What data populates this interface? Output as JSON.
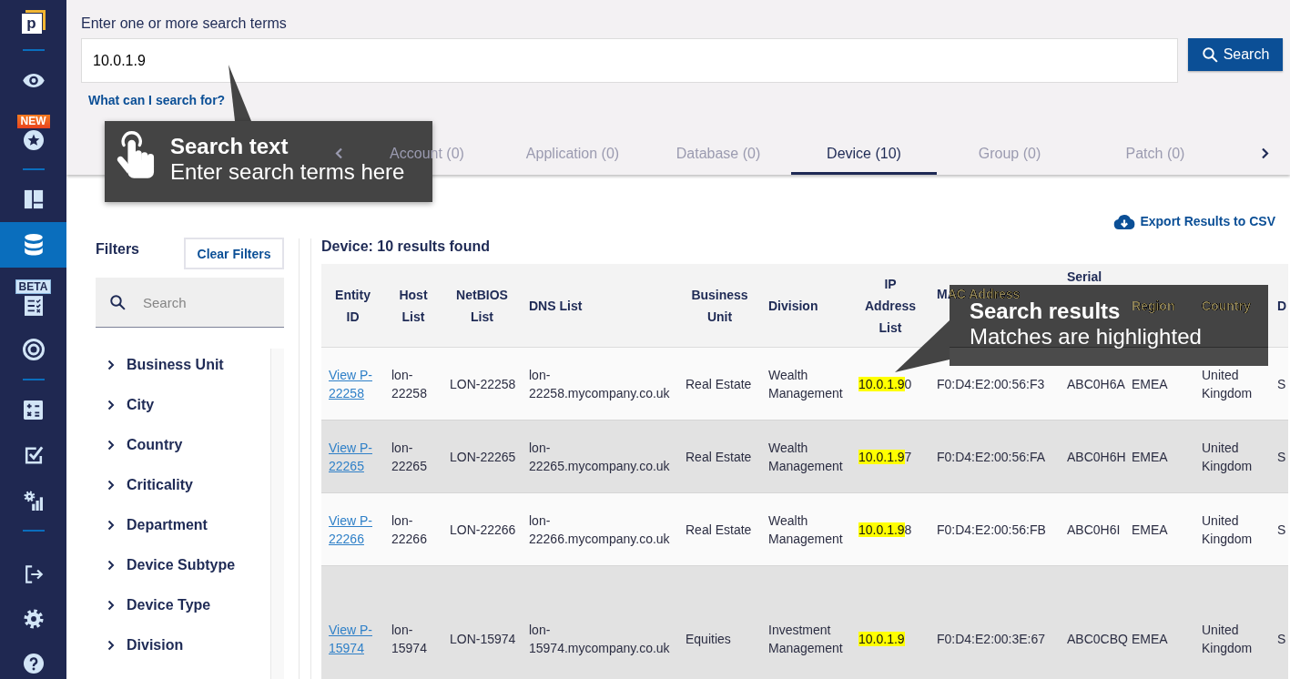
{
  "sidebar": {
    "logo": {
      "text": "p"
    },
    "groups": [
      {
        "items": [
          {
            "kind": "eye",
            "selected": false
          },
          {
            "kind": "star",
            "badge": {
              "kind": "new",
              "text": "NEW"
            },
            "selected": false
          }
        ]
      },
      {
        "items": [
          {
            "kind": "dashboard",
            "selected": false
          },
          {
            "kind": "database",
            "selected": true
          },
          {
            "kind": "checklist",
            "badge": {
              "kind": "beta",
              "text": "BETA"
            },
            "selected": false
          },
          {
            "kind": "target",
            "selected": false
          }
        ]
      },
      {
        "items": [
          {
            "kind": "calculator",
            "selected": false
          },
          {
            "kind": "checkbox",
            "selected": false
          },
          {
            "kind": "gear_chart",
            "selected": false
          }
        ]
      },
      {
        "items": [
          {
            "kind": "logout",
            "selected": false
          },
          {
            "kind": "settings",
            "selected": false
          },
          {
            "kind": "help",
            "selected": false
          }
        ]
      }
    ]
  },
  "search": {
    "label": "Enter one or more search terms",
    "value": "10.0.1.9",
    "button": "Search",
    "help_link": "What can I search for?"
  },
  "tabs": {
    "scroll_left": {
      "disabled": true
    },
    "scroll_right": {
      "disabled": false
    },
    "items": [
      {
        "label": "Account (0)",
        "selected": false
      },
      {
        "label": "Application (0)",
        "selected": false
      },
      {
        "label": "Database (0)",
        "selected": false
      },
      {
        "label": "Device (10)",
        "selected": true
      },
      {
        "label": "Group (0)",
        "selected": false
      },
      {
        "label": "Patch (0)",
        "selected": false
      }
    ]
  },
  "export": {
    "label": "Export Results to CSV"
  },
  "filters": {
    "title": "Filters",
    "clear_button": "Clear Filters",
    "search_placeholder": "Search",
    "items": [
      {
        "label": "Business Unit",
        "expanded": false
      },
      {
        "label": "City",
        "expanded": false
      },
      {
        "label": "Country",
        "expanded": false
      },
      {
        "label": "Criticality",
        "expanded": false
      },
      {
        "label": "Department",
        "expanded": false
      },
      {
        "label": "Device Subtype",
        "expanded": false
      },
      {
        "label": "Device Type",
        "expanded": false
      },
      {
        "label": "Division",
        "expanded": false
      }
    ]
  },
  "results": {
    "heading": "Device: 10 results found",
    "table": {
      "columns": [
        {
          "label": "Entity ID",
          "kind": "link"
        },
        {
          "label": "Host List",
          "kind": "text"
        },
        {
          "label": "NetBIOS List",
          "kind": "text"
        },
        {
          "label": "DNS List",
          "kind": "text"
        },
        {
          "label": "Business Unit",
          "kind": "text"
        },
        {
          "label": "Division",
          "kind": "text"
        },
        {
          "label": "IP Address List",
          "kind": "match"
        },
        {
          "label": "MAC Address",
          "kind": "text"
        },
        {
          "label": "Serial",
          "kind": "text"
        },
        {
          "label": "Region",
          "kind": "text"
        },
        {
          "label": "Country",
          "kind": "text"
        },
        {
          "label": "D",
          "kind": "text"
        }
      ],
      "rows": [
        [
          "View P-22258",
          "lon-22258",
          "LON-22258",
          "lon-22258.mycompany.co.uk",
          "Real Estate",
          "Wealth Management",
          {
            "highlight": "10.0.1.9",
            "rest": "0"
          },
          "F0:D4:E2:00:56:F3",
          "ABC0H6A",
          "EMEA",
          "United Kingdom",
          "S"
        ],
        [
          "View P-22265",
          "lon-22265",
          "LON-22265",
          "lon-22265.mycompany.co.uk",
          "Real Estate",
          "Wealth Management",
          {
            "highlight": "10.0.1.9",
            "rest": "7"
          },
          "F0:D4:E2:00:56:FA",
          "ABC0H6H",
          "EMEA",
          "United Kingdom",
          "S"
        ],
        [
          "View P-22266",
          "lon-22266",
          "LON-22266",
          "lon-22266.mycompany.co.uk",
          "Real Estate",
          "Wealth Management",
          {
            "highlight": "10.0.1.9",
            "rest": "8"
          },
          "F0:D4:E2:00:56:FB",
          "ABC0H6I",
          "EMEA",
          "United Kingdom",
          "S"
        ],
        [
          "View P-15974",
          "lon-15974",
          "LON-15974",
          "lon-15974.mycompany.co.uk",
          "Equities",
          "Investment Management",
          {
            "highlight": "10.0.1.9"
          },
          "F0:D4:E2:00:3E:67",
          "ABC0CBQ",
          "EMEA",
          "United Kingdom",
          "S"
        ]
      ]
    }
  },
  "tooltips": [
    {
      "kind": "icon",
      "title": "Search text",
      "text": "Enter search terms here"
    },
    {
      "kind": "plain",
      "title": "Search results",
      "text": "Matches are highlighted"
    }
  ]
}
